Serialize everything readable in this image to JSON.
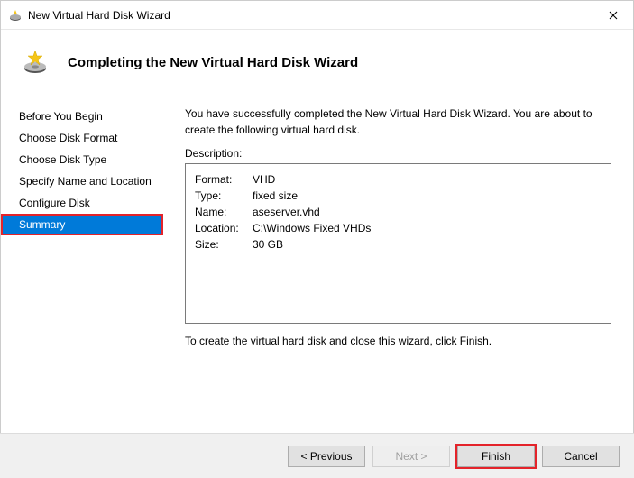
{
  "window": {
    "title": "New Virtual Hard Disk Wizard"
  },
  "header": {
    "title": "Completing the New Virtual Hard Disk Wizard"
  },
  "sidebar": {
    "items": [
      {
        "label": "Before You Begin"
      },
      {
        "label": "Choose Disk Format"
      },
      {
        "label": "Choose Disk Type"
      },
      {
        "label": "Specify Name and Location"
      },
      {
        "label": "Configure Disk"
      },
      {
        "label": "Summary"
      }
    ]
  },
  "main": {
    "intro": "You have successfully completed the New Virtual Hard Disk Wizard. You are about to create the following virtual hard disk.",
    "desc_label": "Description:",
    "description": {
      "format_key": "Format:",
      "format_val": "VHD",
      "type_key": "Type:",
      "type_val": "fixed size",
      "name_key": "Name:",
      "name_val": "aseserver.vhd",
      "location_key": "Location:",
      "location_val": "C:\\Windows Fixed VHDs",
      "size_key": "Size:",
      "size_val": "30 GB"
    },
    "outro": "To create the virtual hard disk and close this wizard, click Finish."
  },
  "footer": {
    "previous": "< Previous",
    "next": "Next >",
    "finish": "Finish",
    "cancel": "Cancel"
  }
}
